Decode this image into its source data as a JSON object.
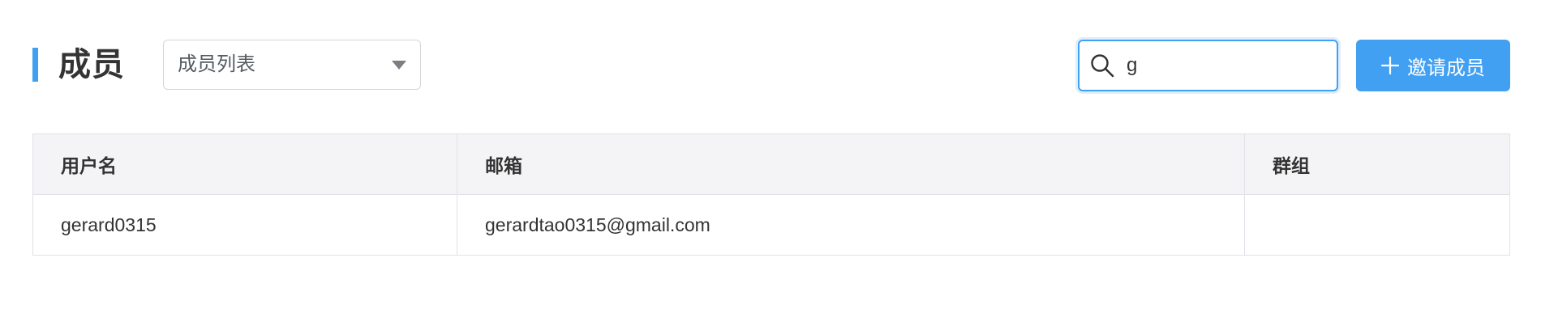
{
  "header": {
    "title": "成员",
    "view_select": {
      "selected": "成员列表"
    },
    "search": {
      "value": "g",
      "placeholder": ""
    },
    "invite_button_label": "邀请成员"
  },
  "table": {
    "columns": [
      "用户名",
      "邮箱",
      "群组"
    ],
    "rows": [
      {
        "username": "gerard0315",
        "email": "gerardtao0315@gmail.com",
        "group": ""
      }
    ]
  },
  "colors": {
    "accent": "#42a0f3",
    "header_bg": "#f4f4f6",
    "border": "#dfe2e6",
    "text": "#333333"
  },
  "icons": {
    "search": "search-icon",
    "plus": "plus-icon",
    "dropdown": "chevron-down-icon"
  }
}
